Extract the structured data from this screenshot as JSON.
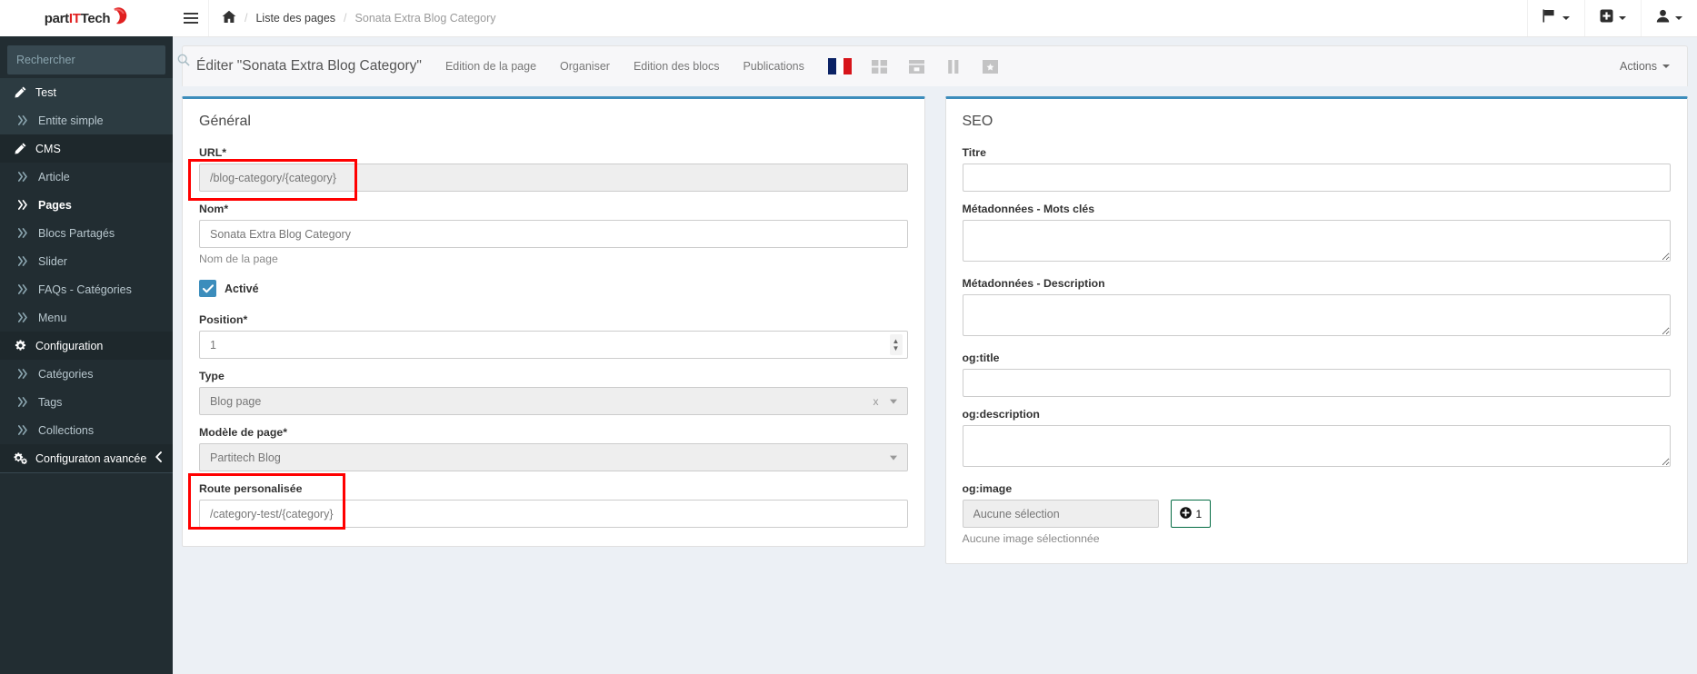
{
  "brand": {
    "name_part1": "part",
    "name_it": "IT",
    "name_part2": "Tech",
    "logo_color": "#e02020"
  },
  "sidebar": {
    "search_placeholder": "Rechercher",
    "search_icon": "search-icon",
    "collapse_icon": "chevron-left-icon",
    "items": [
      {
        "label": "Test",
        "icon": "pencil-icon",
        "type": "header",
        "active": false
      },
      {
        "label": "Entite simple",
        "icon": "angle-double-right-icon",
        "type": "sub",
        "highlight": true
      },
      {
        "label": "CMS",
        "icon": "pencil-icon",
        "type": "header",
        "active": true
      },
      {
        "label": "Article",
        "icon": "angle-double-right-icon",
        "type": "sub"
      },
      {
        "label": "Pages",
        "icon": "angle-double-right-icon",
        "type": "sub",
        "active": true
      },
      {
        "label": "Blocs Partagés",
        "icon": "angle-double-right-icon",
        "type": "sub"
      },
      {
        "label": "Slider",
        "icon": "angle-double-right-icon",
        "type": "sub"
      },
      {
        "label": "FAQs - Catégories",
        "icon": "angle-double-right-icon",
        "type": "sub"
      },
      {
        "label": "Menu",
        "icon": "angle-double-right-icon",
        "type": "sub"
      },
      {
        "label": "Configuration",
        "icon": "gear-icon",
        "type": "header",
        "active": true
      },
      {
        "label": "Catégories",
        "icon": "angle-double-right-icon",
        "type": "sub"
      },
      {
        "label": "Tags",
        "icon": "angle-double-right-icon",
        "type": "sub"
      },
      {
        "label": "Collections",
        "icon": "angle-double-right-icon",
        "type": "sub"
      },
      {
        "label": "Configuraton avancée",
        "icon": "gears-icon",
        "type": "header",
        "active": true,
        "collapse": true
      }
    ]
  },
  "navbar": {
    "toggle_icon": "hamburger-icon",
    "home_icon": "home-icon",
    "breadcrumb": [
      {
        "label": "Liste des pages",
        "current": false
      },
      {
        "label": "Sonata Extra Blog Category",
        "current": true
      }
    ],
    "right_buttons": [
      {
        "icon": "flag-icon",
        "name": "language-menu"
      },
      {
        "icon": "plus-square-icon",
        "name": "add-menu"
      },
      {
        "icon": "user-icon",
        "name": "user-menu"
      }
    ]
  },
  "page_header": {
    "title": "Éditer \"Sonata Extra Blog Category\"",
    "tabs": [
      {
        "label": "Edition de la page"
      },
      {
        "label": "Organiser"
      },
      {
        "label": "Edition des blocs"
      },
      {
        "label": "Publications"
      }
    ],
    "flag": {
      "name": "french-flag-icon",
      "colors": [
        "#0b2265",
        "#ffffff",
        "#d7141a"
      ]
    },
    "layout_icons": [
      {
        "name": "layout-grid-icon"
      },
      {
        "name": "layout-header-icon"
      },
      {
        "name": "layout-two-column-icon"
      },
      {
        "name": "layout-feature-icon"
      }
    ],
    "actions_label": "Actions"
  },
  "general": {
    "title": "Général",
    "url": {
      "label": "URL*",
      "value": "/blog-category/{category}",
      "readonly": true
    },
    "nom": {
      "label": "Nom*",
      "value": "Sonata Extra Blog Category",
      "help": "Nom de la page"
    },
    "active": {
      "label": "Activé",
      "checked": true
    },
    "position": {
      "label": "Position*",
      "value": "1"
    },
    "type": {
      "label": "Type",
      "value": "Blog page",
      "clear": "x"
    },
    "modele": {
      "label": "Modèle de page*",
      "value": "Partitech Blog"
    },
    "route": {
      "label": "Route personalisée",
      "value": "/category-test/{category}"
    }
  },
  "seo": {
    "title": "SEO",
    "titre": {
      "label": "Titre",
      "value": ""
    },
    "mots_cles": {
      "label": "Métadonnées - Mots clés",
      "value": ""
    },
    "description": {
      "label": "Métadonnées - Description",
      "value": ""
    },
    "og_title": {
      "label": "og:title",
      "value": ""
    },
    "og_description": {
      "label": "og:description",
      "value": ""
    },
    "og_image": {
      "label": "og:image",
      "value": "Aucune sélection",
      "button_count": "1",
      "button_icon": "plus-circle-icon",
      "help": "Aucune image sélectionnée"
    }
  },
  "annotations": {
    "accent_blue": "#3c8dbc",
    "highlight_color": "#ff0000",
    "boxes": [
      {
        "name": "url-field-highlight"
      },
      {
        "name": "route-field-highlight"
      }
    ]
  }
}
